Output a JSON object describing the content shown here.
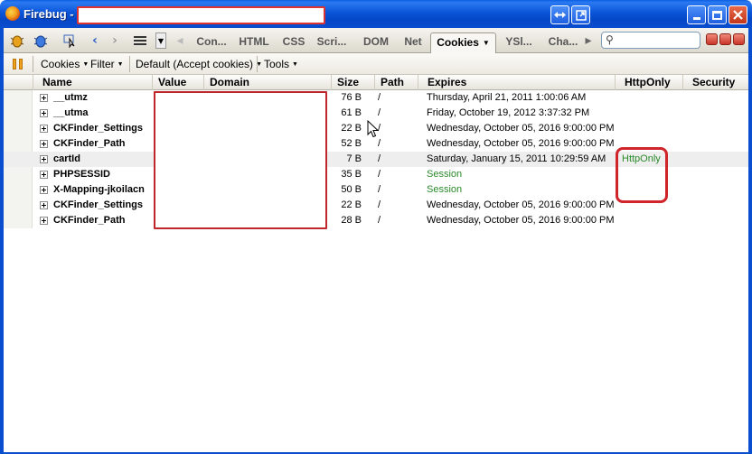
{
  "window": {
    "title": "Firebug -",
    "buttons": [
      "restore-down",
      "detach",
      "minimize",
      "maximize",
      "close"
    ]
  },
  "toolbar": {
    "tabs": [
      {
        "label": "Con...",
        "active": false
      },
      {
        "label": "HTML",
        "active": false
      },
      {
        "label": "CSS",
        "active": false
      },
      {
        "label": "Scri...",
        "active": false
      },
      {
        "label": "DOM",
        "active": false
      },
      {
        "label": "Net",
        "active": false
      },
      {
        "label": "Cookies",
        "active": true
      },
      {
        "label": "YSl...",
        "active": false
      },
      {
        "label": "Cha...",
        "active": false
      }
    ],
    "search_placeholder": ""
  },
  "subtoolbar": {
    "cookies": "Cookies",
    "filter": "Filter",
    "permissions": "Default (Accept cookies)",
    "tools": "Tools"
  },
  "table": {
    "columns": [
      "Name",
      "Value",
      "Domain",
      "Size",
      "Path",
      "Expires",
      "HttpOnly",
      "Security"
    ],
    "rows": [
      {
        "name": "__utmz",
        "size": "76 B",
        "path": "/",
        "expires": "Thursday, April 21, 2011 1:00:06 AM",
        "httponly": "",
        "highlighted": false
      },
      {
        "name": "__utma",
        "size": "61 B",
        "path": "/",
        "expires": "Friday, October 19, 2012 3:37:32 PM",
        "httponly": "",
        "highlighted": false
      },
      {
        "name": "CKFinder_Settings",
        "size": "22 B",
        "path": "/",
        "expires": "Wednesday, October 05, 2016 9:00:00 PM",
        "httponly": "",
        "highlighted": false
      },
      {
        "name": "CKFinder_Path",
        "size": "52 B",
        "path": "/",
        "expires": "Wednesday, October 05, 2016 9:00:00 PM",
        "httponly": "",
        "highlighted": false
      },
      {
        "name": "cartId",
        "size": "7 B",
        "path": "/",
        "expires": "Saturday, January 15, 2011 10:29:59 AM",
        "httponly": "HttpOnly",
        "highlighted": true
      },
      {
        "name": "PHPSESSID",
        "size": "35 B",
        "path": "/",
        "expires": "Session",
        "httponly": "",
        "highlighted": false
      },
      {
        "name": "X-Mapping-jkoilacn",
        "size": "50 B",
        "path": "/",
        "expires": "Session",
        "httponly": "",
        "highlighted": false
      },
      {
        "name": "CKFinder_Settings",
        "size": "22 B",
        "path": "/",
        "expires": "Wednesday, October 05, 2016 9:00:00 PM",
        "httponly": "",
        "highlighted": false
      },
      {
        "name": "CKFinder_Path",
        "size": "28 B",
        "path": "/",
        "expires": "Wednesday, October 05, 2016 9:00:00 PM",
        "httponly": "",
        "highlighted": false
      }
    ]
  },
  "colors": {
    "titlebar": "#0a4ed0",
    "session_text": "#2a8a2a",
    "annotation": "#d0242a"
  }
}
